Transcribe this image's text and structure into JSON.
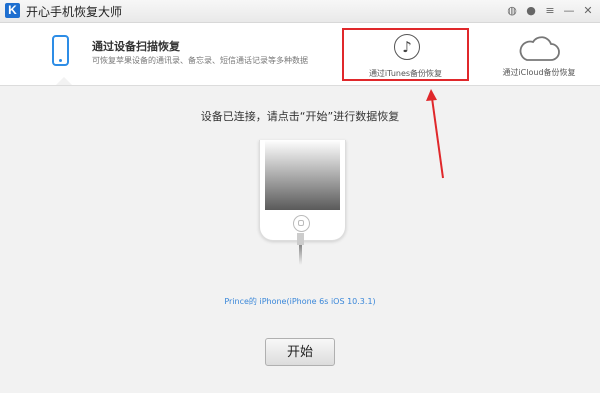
{
  "titlebar": {
    "logo_letter": "K",
    "title": "开心手机恢复大师",
    "icons": [
      "wechat-icon",
      "message-icon",
      "menu-icon",
      "minimize-icon",
      "close-icon"
    ],
    "icon_glyphs": [
      "◍",
      "●",
      "≡",
      "—",
      "✕"
    ]
  },
  "tabs": {
    "device": {
      "title": "通过设备扫描恢复",
      "desc": "可恢复苹果设备的通讯录、备忘录、短信通话记录等多种数据",
      "accent_color": "#2d8de6"
    },
    "itunes": {
      "label": "通过iTunes备份恢复",
      "icon_glyph": "♪",
      "highlight_color": "#e0282b"
    },
    "icloud": {
      "label": "通过iCloud备份恢复"
    }
  },
  "main": {
    "instruction": "设备已连接，请点击“开始”进行数据恢复",
    "device_info": "Prince的 iPhone(iPhone 6s iOS 10.3.1)",
    "start_label": "开始"
  }
}
